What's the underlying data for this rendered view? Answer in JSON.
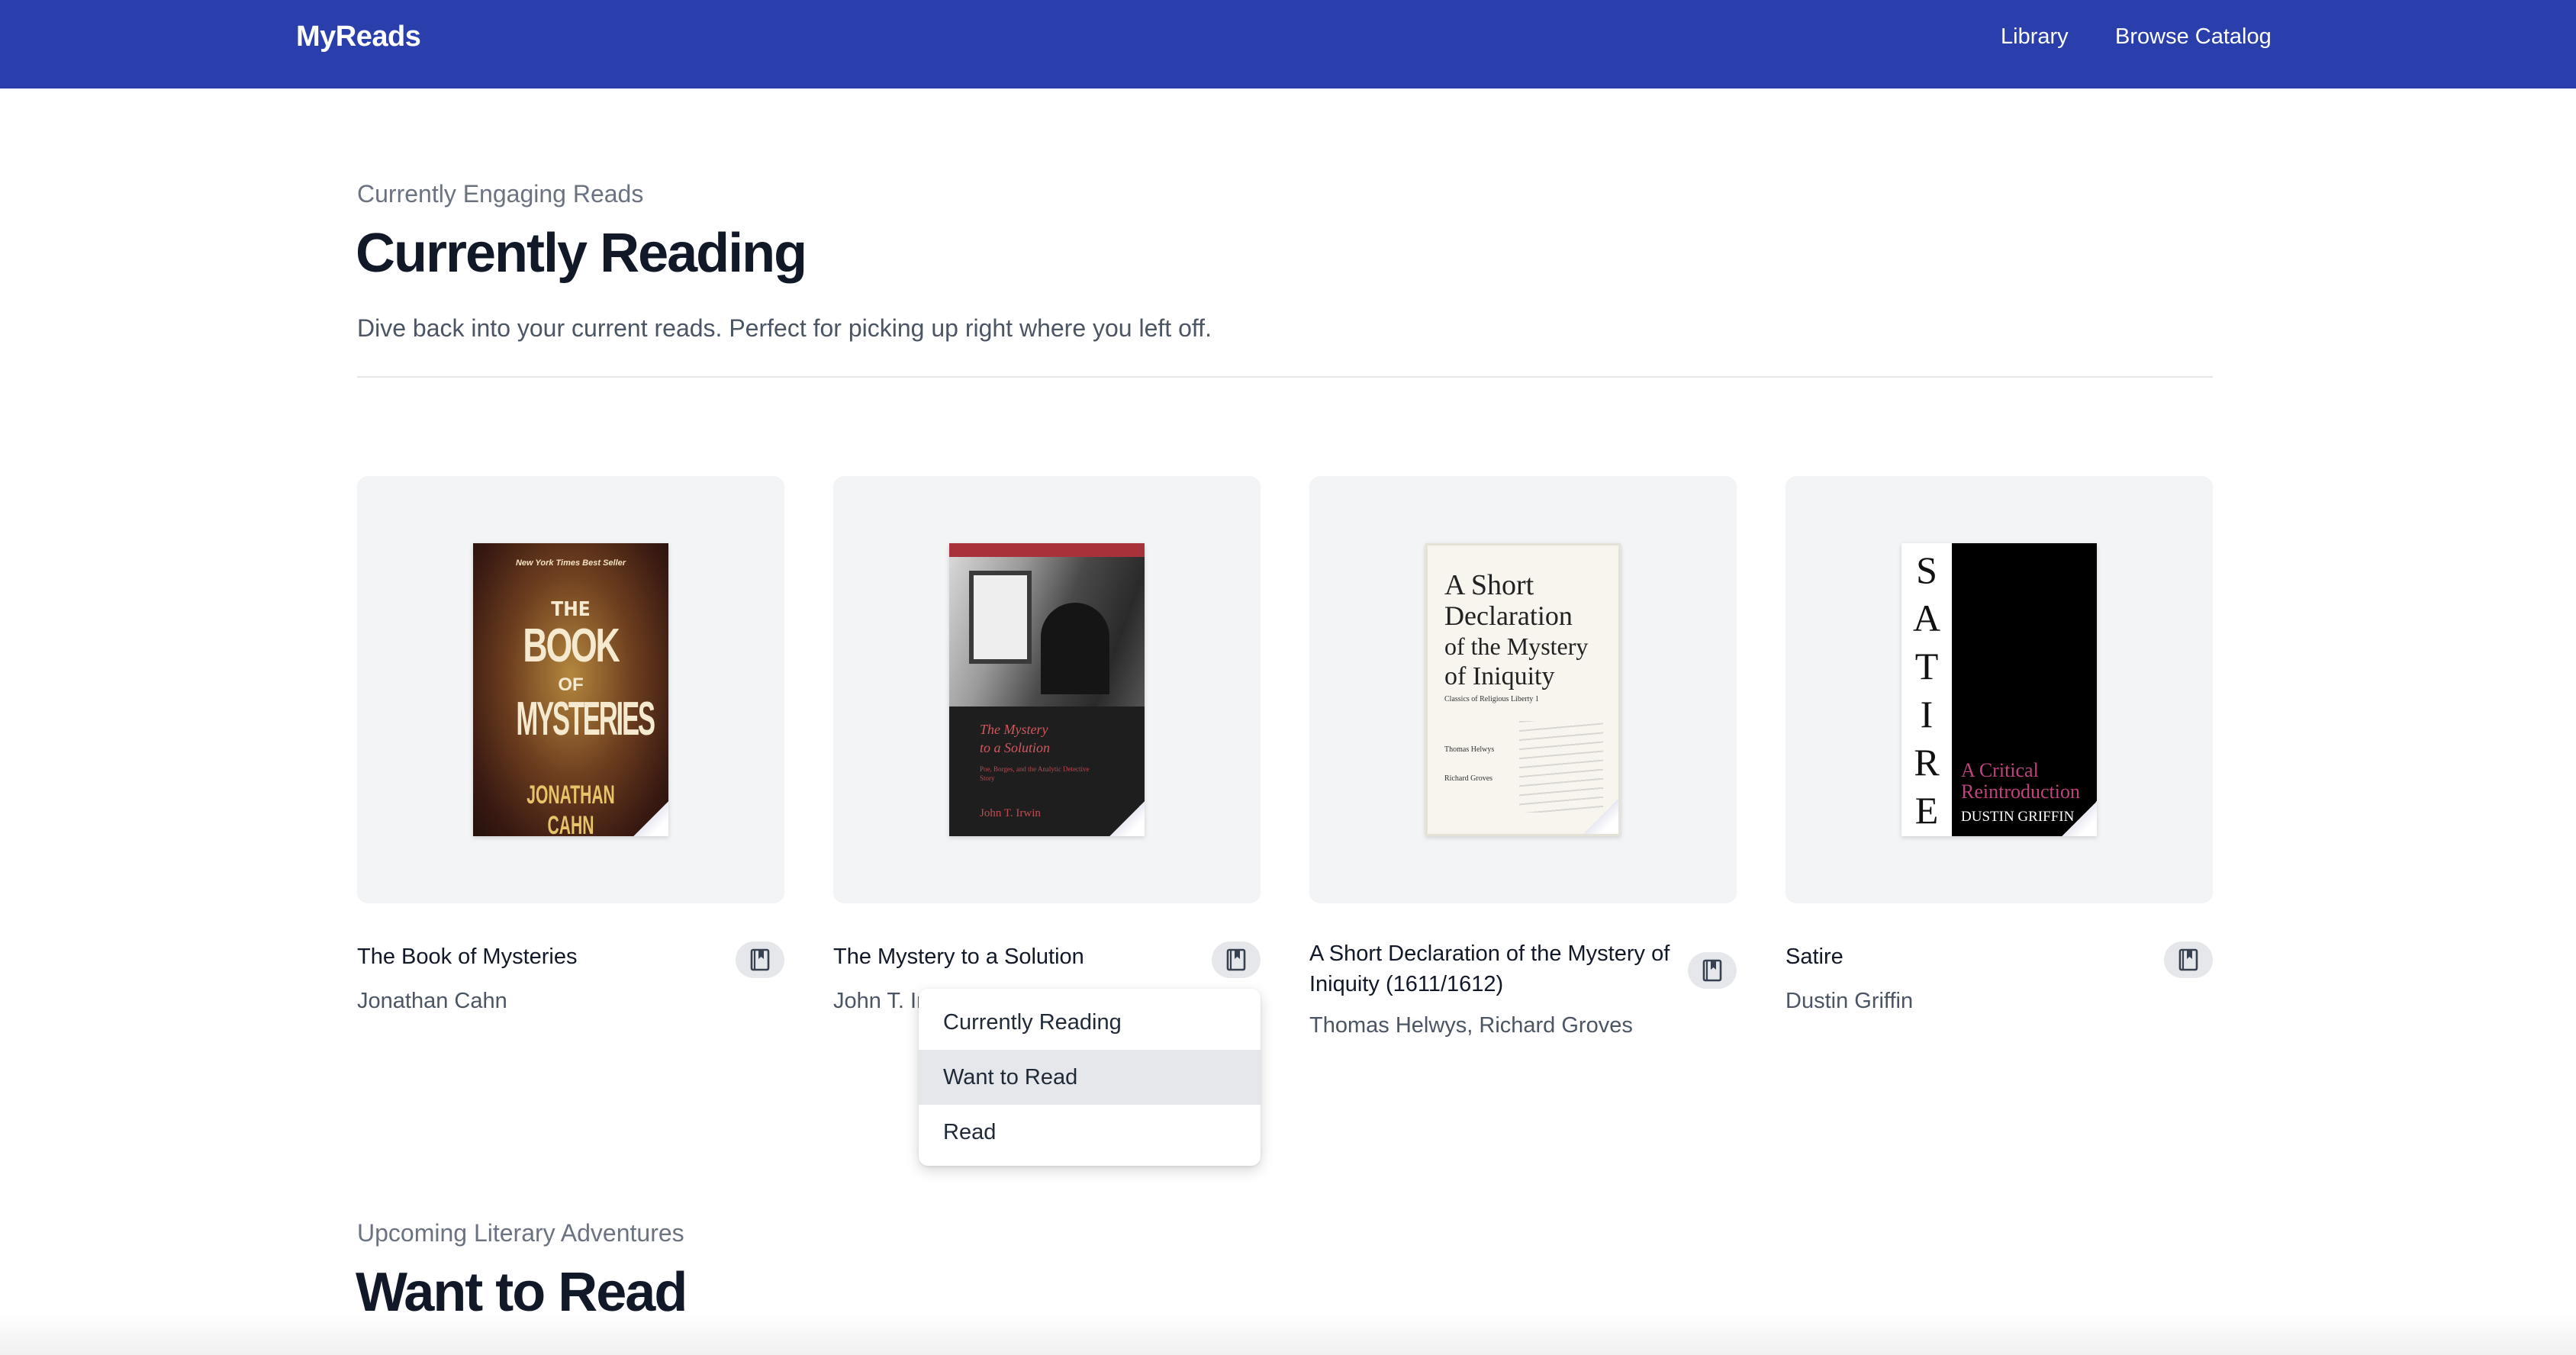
{
  "header": {
    "brand": "MyReads",
    "nav": {
      "library": "Library",
      "browse": "Browse Catalog"
    },
    "background": "#2a3fab"
  },
  "current_section": {
    "eyebrow": "Currently Engaging Reads",
    "title": "Currently Reading",
    "description": "Dive back into your current reads. Perfect for picking up right where you left off."
  },
  "books": [
    {
      "title": "The Book of Mysteries",
      "author": "Jonathan Cahn",
      "cover": {
        "top_line": "New York Times Best Seller",
        "title_a": "THE",
        "title_b": "BOOK",
        "title_c": "OF",
        "title_d": "MYSTERIES",
        "author": "JONATHAN CAHN"
      }
    },
    {
      "title": "The Mystery to a Solution",
      "author": "John T. Irwin",
      "cover": {
        "title_a": "The Mystery",
        "title_b": "to a Solution",
        "subtitle": "Poe, Borges, and the Analytic Detective Story",
        "author": "John T. Irwin"
      }
    },
    {
      "title": "A Short Declaration of the Mystery of Iniquity (1611/1612)",
      "author": "Thomas Helwys, Richard Groves",
      "cover": {
        "title_a": "A Short",
        "title_b": "Declaration",
        "title_c": "of the Mystery",
        "title_d": "of Iniquity",
        "series": "Classics of Religious Liberty 1",
        "author_a": "Thomas Helwys",
        "author_b": "Richard Groves"
      }
    },
    {
      "title": "Satire",
      "author": "Dustin Griffin",
      "cover": {
        "letters": [
          "S",
          "A",
          "T",
          "I",
          "R",
          "E"
        ],
        "subtitle_a": "A Critical",
        "subtitle_b": "Reintroduction",
        "author": "DUSTIN GRIFFIN"
      }
    }
  ],
  "shelf_menu": {
    "items": [
      "Currently Reading",
      "Want to Read",
      "Read"
    ],
    "highlighted": "Want to Read"
  },
  "want_section": {
    "eyebrow": "Upcoming Literary Adventures",
    "title": "Want to Read"
  },
  "icons": {
    "shelf_button": "bookmark-book-icon"
  }
}
